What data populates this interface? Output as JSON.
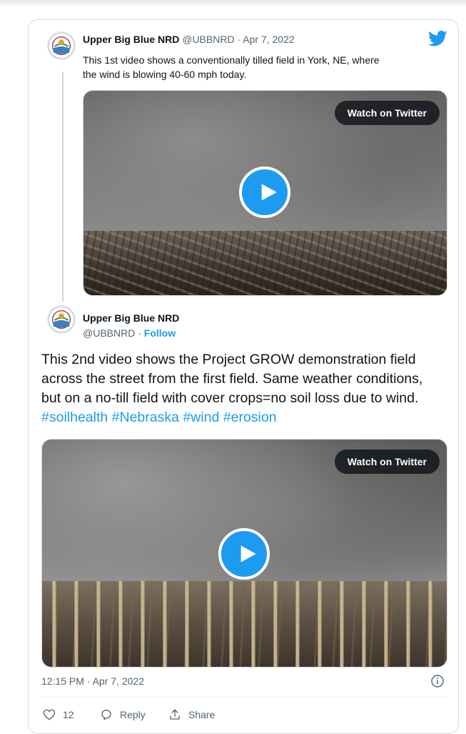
{
  "tweet1": {
    "name": "Upper Big Blue NRD",
    "handle": "@UBBNRD",
    "separator": "·",
    "date": "Apr 7, 2022",
    "text_line1": "This 1st video shows a conventionally tilled field in York, NE, where",
    "text_line2": "the wind is blowing 40-60 mph today.",
    "media_button": "Watch on Twitter"
  },
  "tweet2": {
    "name": "Upper Big Blue NRD",
    "handle": "@UBBNRD",
    "separator": "·",
    "follow_label": "Follow",
    "text": "This 2nd video shows the Project GROW demonstration field across the street from the first field. Same weather conditions, but on a no-till field with cover crops=no soil loss due to wind.",
    "hashtags": [
      "#soilhealth",
      "#Nebraska",
      "#wind",
      "#erosion"
    ],
    "media_button": "Watch on Twitter",
    "timestamp": "12:15 PM · Apr 7, 2022",
    "like_count": "12",
    "reply_label": "Reply",
    "share_label": "Share"
  },
  "icons": {
    "brand": "twitter-bird-icon",
    "play": "play-icon",
    "info": "info-icon",
    "like": "heart-icon",
    "reply": "reply-icon",
    "share": "share-icon"
  },
  "colors": {
    "accent": "#1d9bf0",
    "text": "#0f1419",
    "muted": "#536471",
    "border": "#cfd9de"
  }
}
